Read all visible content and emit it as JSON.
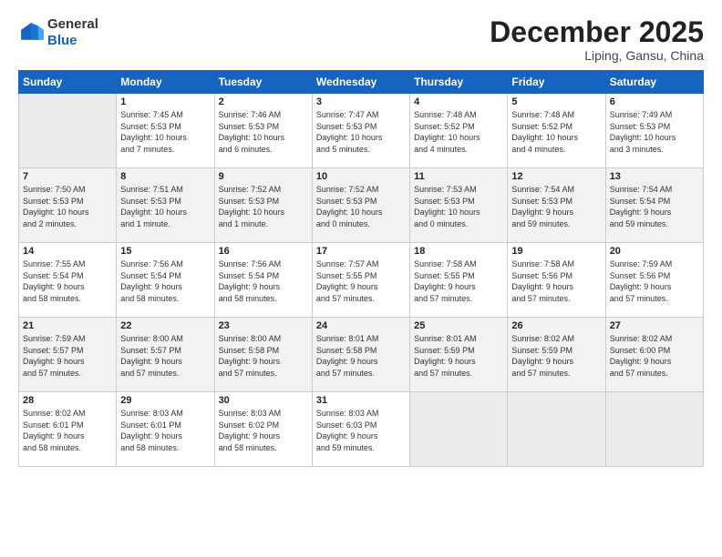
{
  "logo": {
    "general": "General",
    "blue": "Blue"
  },
  "title": "December 2025",
  "subtitle": "Liping, Gansu, China",
  "days_of_week": [
    "Sunday",
    "Monday",
    "Tuesday",
    "Wednesday",
    "Thursday",
    "Friday",
    "Saturday"
  ],
  "weeks": [
    [
      {
        "day": "",
        "detail": ""
      },
      {
        "day": "1",
        "detail": "Sunrise: 7:45 AM\nSunset: 5:53 PM\nDaylight: 10 hours\nand 7 minutes."
      },
      {
        "day": "2",
        "detail": "Sunrise: 7:46 AM\nSunset: 5:53 PM\nDaylight: 10 hours\nand 6 minutes."
      },
      {
        "day": "3",
        "detail": "Sunrise: 7:47 AM\nSunset: 5:53 PM\nDaylight: 10 hours\nand 5 minutes."
      },
      {
        "day": "4",
        "detail": "Sunrise: 7:48 AM\nSunset: 5:52 PM\nDaylight: 10 hours\nand 4 minutes."
      },
      {
        "day": "5",
        "detail": "Sunrise: 7:48 AM\nSunset: 5:52 PM\nDaylight: 10 hours\nand 4 minutes."
      },
      {
        "day": "6",
        "detail": "Sunrise: 7:49 AM\nSunset: 5:53 PM\nDaylight: 10 hours\nand 3 minutes."
      }
    ],
    [
      {
        "day": "7",
        "detail": "Sunrise: 7:50 AM\nSunset: 5:53 PM\nDaylight: 10 hours\nand 2 minutes."
      },
      {
        "day": "8",
        "detail": "Sunrise: 7:51 AM\nSunset: 5:53 PM\nDaylight: 10 hours\nand 1 minute."
      },
      {
        "day": "9",
        "detail": "Sunrise: 7:52 AM\nSunset: 5:53 PM\nDaylight: 10 hours\nand 1 minute."
      },
      {
        "day": "10",
        "detail": "Sunrise: 7:52 AM\nSunset: 5:53 PM\nDaylight: 10 hours\nand 0 minutes."
      },
      {
        "day": "11",
        "detail": "Sunrise: 7:53 AM\nSunset: 5:53 PM\nDaylight: 10 hours\nand 0 minutes."
      },
      {
        "day": "12",
        "detail": "Sunrise: 7:54 AM\nSunset: 5:53 PM\nDaylight: 9 hours\nand 59 minutes."
      },
      {
        "day": "13",
        "detail": "Sunrise: 7:54 AM\nSunset: 5:54 PM\nDaylight: 9 hours\nand 59 minutes."
      }
    ],
    [
      {
        "day": "14",
        "detail": "Sunrise: 7:55 AM\nSunset: 5:54 PM\nDaylight: 9 hours\nand 58 minutes."
      },
      {
        "day": "15",
        "detail": "Sunrise: 7:56 AM\nSunset: 5:54 PM\nDaylight: 9 hours\nand 58 minutes."
      },
      {
        "day": "16",
        "detail": "Sunrise: 7:56 AM\nSunset: 5:54 PM\nDaylight: 9 hours\nand 58 minutes."
      },
      {
        "day": "17",
        "detail": "Sunrise: 7:57 AM\nSunset: 5:55 PM\nDaylight: 9 hours\nand 57 minutes."
      },
      {
        "day": "18",
        "detail": "Sunrise: 7:58 AM\nSunset: 5:55 PM\nDaylight: 9 hours\nand 57 minutes."
      },
      {
        "day": "19",
        "detail": "Sunrise: 7:58 AM\nSunset: 5:56 PM\nDaylight: 9 hours\nand 57 minutes."
      },
      {
        "day": "20",
        "detail": "Sunrise: 7:59 AM\nSunset: 5:56 PM\nDaylight: 9 hours\nand 57 minutes."
      }
    ],
    [
      {
        "day": "21",
        "detail": "Sunrise: 7:59 AM\nSunset: 5:57 PM\nDaylight: 9 hours\nand 57 minutes."
      },
      {
        "day": "22",
        "detail": "Sunrise: 8:00 AM\nSunset: 5:57 PM\nDaylight: 9 hours\nand 57 minutes."
      },
      {
        "day": "23",
        "detail": "Sunrise: 8:00 AM\nSunset: 5:58 PM\nDaylight: 9 hours\nand 57 minutes."
      },
      {
        "day": "24",
        "detail": "Sunrise: 8:01 AM\nSunset: 5:58 PM\nDaylight: 9 hours\nand 57 minutes."
      },
      {
        "day": "25",
        "detail": "Sunrise: 8:01 AM\nSunset: 5:59 PM\nDaylight: 9 hours\nand 57 minutes."
      },
      {
        "day": "26",
        "detail": "Sunrise: 8:02 AM\nSunset: 5:59 PM\nDaylight: 9 hours\nand 57 minutes."
      },
      {
        "day": "27",
        "detail": "Sunrise: 8:02 AM\nSunset: 6:00 PM\nDaylight: 9 hours\nand 57 minutes."
      }
    ],
    [
      {
        "day": "28",
        "detail": "Sunrise: 8:02 AM\nSunset: 6:01 PM\nDaylight: 9 hours\nand 58 minutes."
      },
      {
        "day": "29",
        "detail": "Sunrise: 8:03 AM\nSunset: 6:01 PM\nDaylight: 9 hours\nand 58 minutes."
      },
      {
        "day": "30",
        "detail": "Sunrise: 8:03 AM\nSunset: 6:02 PM\nDaylight: 9 hours\nand 58 minutes."
      },
      {
        "day": "31",
        "detail": "Sunrise: 8:03 AM\nSunset: 6:03 PM\nDaylight: 9 hours\nand 59 minutes."
      },
      {
        "day": "",
        "detail": ""
      },
      {
        "day": "",
        "detail": ""
      },
      {
        "day": "",
        "detail": ""
      }
    ]
  ]
}
